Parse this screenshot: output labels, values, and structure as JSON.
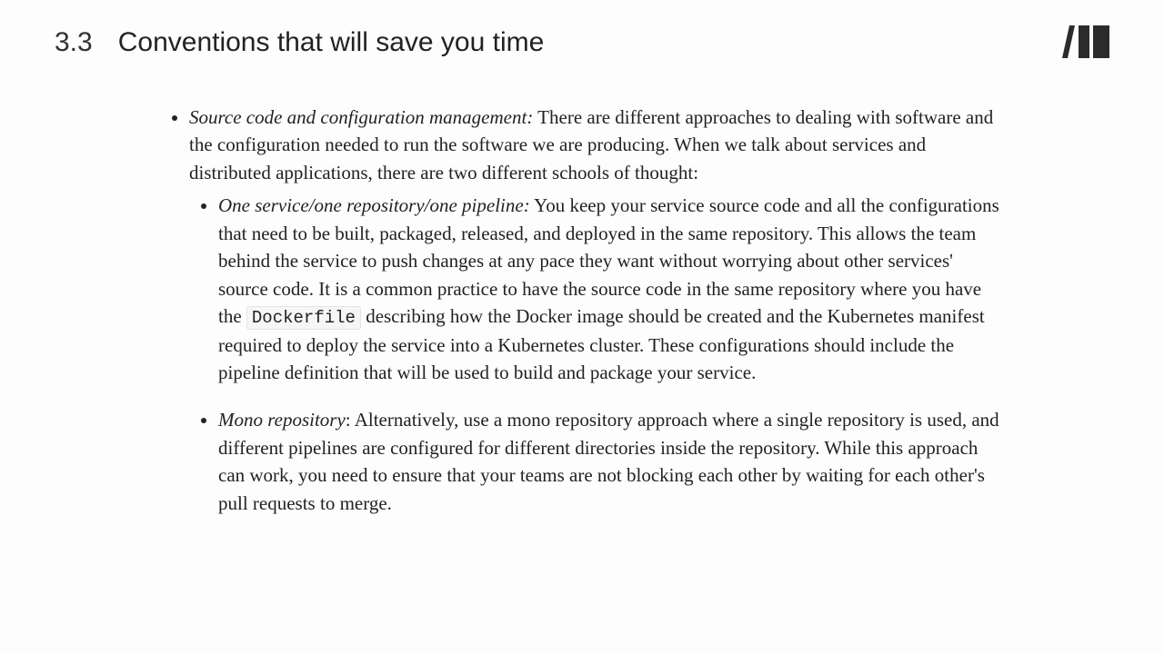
{
  "header": {
    "section_number": "3.3",
    "section_title": "Conventions that will save you time"
  },
  "bullets": {
    "top": {
      "lead": "Source code and configuration management:",
      "text": " There are different approaches to dealing with software and the configuration needed to run the software we are producing. When we talk about services and distributed applications, there are two different schools of thought:"
    },
    "sub1": {
      "lead": "One service/one repository/one pipeline:",
      "text_before_code": " You keep your service source code and all the configurations that need to be built, packaged, released, and deployed in the same repository. This allows the team behind the service to push changes at any pace they want without worrying about other services' source code. It is a common practice to have the source code in the same repository where you have the ",
      "code": "Dockerfile",
      "text_after_code": " describing how the Docker image should be created and the Kubernetes manifest required to deploy the service into a Kubernetes cluster. These configurations should include the pipeline definition that will be used to build and package your service."
    },
    "sub2": {
      "lead": "Mono repository",
      "text": ": Alternatively, use a mono repository approach where a single repository is used, and different pipelines are configured for different directories inside the repository. While this approach can work, you need to ensure that your teams are not blocking each other by waiting for each other's pull requests to merge."
    }
  }
}
